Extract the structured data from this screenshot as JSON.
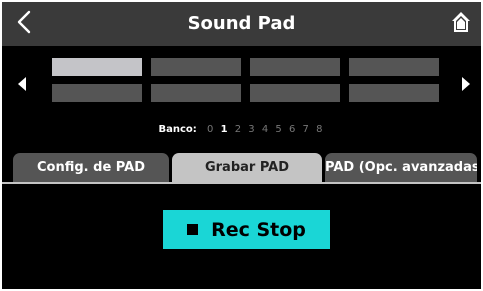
{
  "header": {
    "title": "Sound Pad"
  },
  "pads": {
    "selected_index": 0,
    "count": 8
  },
  "bank": {
    "label": "Banco:",
    "numbers": [
      "0",
      "1",
      "2",
      "3",
      "4",
      "5",
      "6",
      "7",
      "8"
    ],
    "active_index": 1
  },
  "tabs": [
    {
      "label": "Config. de PAD",
      "active": false
    },
    {
      "label": "Grabar PAD",
      "active": true
    },
    {
      "label": "PAD (Opc. avanzadas)",
      "active": false
    }
  ],
  "rec_button": {
    "label": "Rec Stop"
  },
  "colors": {
    "accent": "#1ad6d6",
    "header_bg": "#3a3a3a",
    "pad_selected": "#c4c4c8",
    "pad_default": "#555555"
  },
  "icons": {
    "back": "chevron-left-icon",
    "home": "home-icon",
    "prev": "triangle-left-icon",
    "next": "triangle-right-icon",
    "stop": "stop-square-icon"
  }
}
